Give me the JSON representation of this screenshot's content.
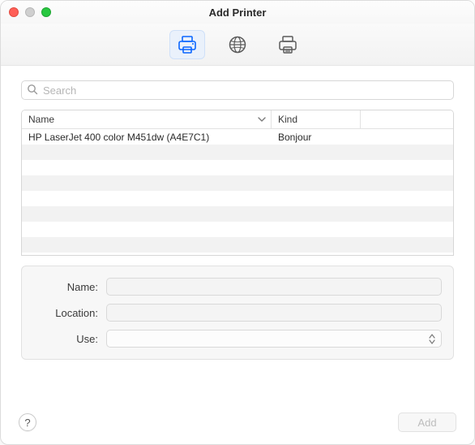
{
  "window": {
    "title": "Add Printer"
  },
  "toolbar": {
    "items": [
      {
        "name": "default-printer-tab",
        "selected": true
      },
      {
        "name": "ip-printer-tab",
        "selected": false
      },
      {
        "name": "windows-printer-tab",
        "selected": false
      }
    ]
  },
  "search": {
    "placeholder": "Search",
    "value": ""
  },
  "list": {
    "columns": {
      "name": "Name",
      "kind": "Kind"
    },
    "rows": [
      {
        "name": "HP LaserJet 400 color M451dw (A4E7C1)",
        "kind": "Bonjour"
      }
    ]
  },
  "form": {
    "labels": {
      "name": "Name:",
      "location": "Location:",
      "use": "Use:"
    },
    "values": {
      "name": "",
      "location": "",
      "use": ""
    }
  },
  "footer": {
    "help_label": "?",
    "add_label": "Add",
    "add_enabled": false
  },
  "colors": {
    "accent": "#0a66ff"
  }
}
